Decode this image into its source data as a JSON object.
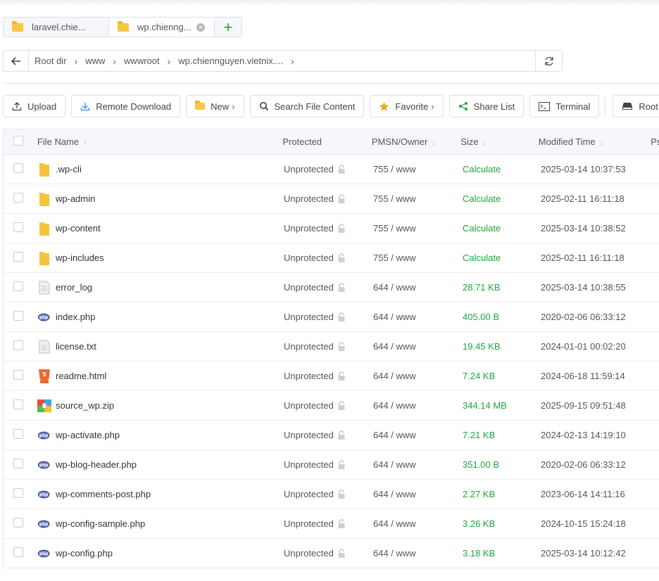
{
  "tabs": [
    {
      "label": "laravel.chie...",
      "active": false
    },
    {
      "label": "wp.chienng...",
      "active": true
    }
  ],
  "tab_add_label": "+",
  "breadcrumb": [
    "Root dir",
    "www",
    "wwwroot",
    "wp.chiennguyen.vietnix...."
  ],
  "toolbar": [
    {
      "label": "Upload",
      "icon": "upload-icon"
    },
    {
      "label": "Remote Download",
      "icon": "download-icon"
    },
    {
      "label": "New",
      "icon": "folder-icon",
      "chevron": true
    },
    {
      "label": "Search File Content",
      "icon": "search-icon"
    },
    {
      "label": "Favorite",
      "icon": "star-icon",
      "chevron": true
    },
    {
      "label": "Share List",
      "icon": "share-icon"
    },
    {
      "label": "Terminal",
      "icon": "terminal-icon"
    },
    {
      "label": "Root dir",
      "icon": "disk-icon"
    }
  ],
  "columns": {
    "name": "File Name",
    "protected": "Protected",
    "perm": "PMSN/Owner",
    "size": "Size",
    "time": "Modified Time",
    "ps": "Ps"
  },
  "files": [
    {
      "name": ".wp-cli",
      "type": "folder",
      "protected": "Unprotected",
      "perm": "755 / www",
      "size": "Calculate",
      "time": "2025-03-14 10:37:53"
    },
    {
      "name": "wp-admin",
      "type": "folder",
      "protected": "Unprotected",
      "perm": "755 / www",
      "size": "Calculate",
      "time": "2025-02-11 16:11:18"
    },
    {
      "name": "wp-content",
      "type": "folder",
      "protected": "Unprotected",
      "perm": "755 / www",
      "size": "Calculate",
      "time": "2025-03-14 10:38:52"
    },
    {
      "name": "wp-includes",
      "type": "folder",
      "protected": "Unprotected",
      "perm": "755 / www",
      "size": "Calculate",
      "time": "2025-02-11 16:11:18"
    },
    {
      "name": "error_log",
      "type": "text",
      "protected": "Unprotected",
      "perm": "644 / www",
      "size": "28.71 KB",
      "time": "2025-03-14 10:38:55"
    },
    {
      "name": "index.php",
      "type": "php",
      "protected": "Unprotected",
      "perm": "644 / www",
      "size": "405.00 B",
      "time": "2020-02-06 06:33:12"
    },
    {
      "name": "license.txt",
      "type": "text",
      "protected": "Unprotected",
      "perm": "644 / www",
      "size": "19.45 KB",
      "time": "2024-01-01 00:02:20"
    },
    {
      "name": "readme.html",
      "type": "html",
      "protected": "Unprotected",
      "perm": "644 / www",
      "size": "7.24 KB",
      "time": "2024-06-18 11:59:14"
    },
    {
      "name": "source_wp.zip",
      "type": "zip",
      "protected": "Unprotected",
      "perm": "644 / www",
      "size": "344.14 MB",
      "time": "2025-09-15 09:51:48"
    },
    {
      "name": "wp-activate.php",
      "type": "php",
      "protected": "Unprotected",
      "perm": "644 / www",
      "size": "7.21 KB",
      "time": "2024-02-13 14:19:10"
    },
    {
      "name": "wp-blog-header.php",
      "type": "php",
      "protected": "Unprotected",
      "perm": "644 / www",
      "size": "351.00 B",
      "time": "2020-02-06 06:33:12"
    },
    {
      "name": "wp-comments-post.php",
      "type": "php",
      "protected": "Unprotected",
      "perm": "644 / www",
      "size": "2.27 KB",
      "time": "2023-06-14 14:11:16"
    },
    {
      "name": "wp-config-sample.php",
      "type": "php",
      "protected": "Unprotected",
      "perm": "644 / www",
      "size": "3.26 KB",
      "time": "2024-10-15 15:24:18"
    },
    {
      "name": "wp-config.php",
      "type": "php",
      "protected": "Unprotected",
      "perm": "644 / www",
      "size": "3.18 KB",
      "time": "2025-03-14 10:12:42"
    }
  ],
  "colors": {
    "accent": "#20a53a",
    "folder": "#f9c843"
  }
}
